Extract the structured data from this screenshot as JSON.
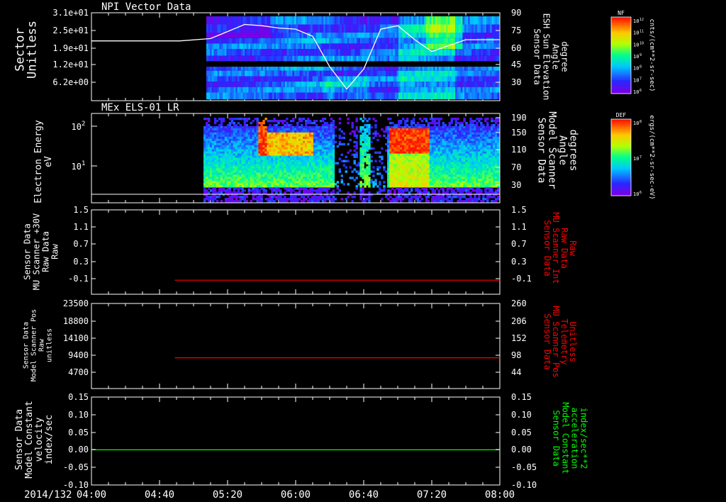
{
  "date_label": "2014/132",
  "time_axis": {
    "start": "04:00",
    "end": "08:00",
    "tick_labels": [
      "04:00",
      "04:40",
      "05:20",
      "06:00",
      "06:40",
      "07:20",
      "08:00"
    ]
  },
  "colors": {
    "background": "#000000",
    "frame": "#ffffff",
    "red_trace": "#ff0000",
    "green_trace": "#00ff00"
  },
  "panels": [
    {
      "id": "npi",
      "title": "NPI Vector Data",
      "left_label": [
        "Sector",
        "Unitless"
      ],
      "left_ticks": [
        "3.1e+01",
        "2.5e+01",
        "1.9e+01",
        "1.2e+01",
        "6.2e+00"
      ],
      "right_label": [
        "Sensor Data",
        "ESH Sun Elevation",
        "Angle",
        "degree"
      ],
      "right_ticks": [
        "90",
        "75",
        "60",
        "45",
        "30"
      ],
      "colorbar": {
        "label": "NF",
        "units": "cnts/(cm**2-sr-sec)",
        "ticks": [
          "10^12",
          "10^11",
          "10^10",
          "10^9",
          "10^8",
          "10^7",
          "10^6"
        ]
      }
    },
    {
      "id": "els",
      "title": "MEx ELS-01 LR",
      "left_label": [
        "Electron Energy",
        "eV"
      ],
      "left_ticks": [
        "10^2",
        "10^1"
      ],
      "right_label": [
        "Sensor Data",
        "Model Scanner",
        "Angle",
        "degrees"
      ],
      "right_ticks": [
        "190",
        "150",
        "110",
        "70",
        "30"
      ],
      "colorbar": {
        "label": "DEF",
        "units": "ergs/(cm**2-sr-sec-eV)",
        "ticks": [
          "10^8",
          "10^7",
          "10^6"
        ]
      }
    },
    {
      "id": "mu_int",
      "left_label": [
        "Sensor Data",
        "MU Scanner +30V",
        "Raw Data",
        "Raw"
      ],
      "left_ticks": [
        "1.5",
        "1.1",
        "0.7",
        "0.3",
        "-0.1"
      ],
      "right_label": [
        "Sensor Data",
        "MU Scanner Int",
        "Raw Data",
        "Raw"
      ],
      "right_ticks": [
        "1.5",
        "1.1",
        "0.7",
        "0.3",
        "-0.1"
      ]
    },
    {
      "id": "mu_pos",
      "left_label": [
        "Sensor Data",
        "Model Scanner Pos",
        "Raw",
        "unitless"
      ],
      "left_ticks": [
        "23500",
        "18800",
        "14100",
        "9400",
        "4700"
      ],
      "right_label": [
        "Sensor Data",
        "MU Scanner Pos",
        "Telemetry",
        "Unitless"
      ],
      "right_ticks": [
        "260",
        "206",
        "152",
        "98",
        "44"
      ]
    },
    {
      "id": "model_const",
      "left_label": [
        "Sensor Data",
        "Model Constant",
        "velocity",
        "index/sec"
      ],
      "left_ticks": [
        "0.15",
        "0.10",
        "0.05",
        "0.00",
        "-0.05",
        "-0.10"
      ],
      "right_label": [
        "Sensor Data",
        "Model Constant",
        "acceleration",
        "index/sec**2"
      ],
      "right_ticks": [
        "0.15",
        "0.10",
        "0.05",
        "0.00",
        "-0.05",
        "-0.10"
      ]
    }
  ],
  "chart_data": [
    {
      "type": "heatmap",
      "title": "NPI Vector Data",
      "ylabel": "Sector Unitless",
      "y2label": "Sensor Data ESH Sun Elevation Angle degree",
      "xlim": [
        "04:00",
        "08:00"
      ],
      "ylim": [
        0,
        31
      ],
      "y2lim": [
        15,
        90
      ],
      "data_start": "04:52",
      "overlay_series": {
        "name": "ESH Sun Elevation Angle",
        "x": [
          "04:00",
          "04:52",
          "05:10",
          "05:20",
          "05:30",
          "05:40",
          "05:50",
          "06:00",
          "06:10",
          "06:20",
          "06:30",
          "06:40",
          "06:50",
          "07:00",
          "07:10",
          "07:20",
          "07:30",
          "07:40",
          "08:00"
        ],
        "y": [
          66,
          66,
          68,
          74,
          80,
          79,
          77,
          76,
          70,
          44,
          25,
          42,
          76,
          79,
          67,
          57,
          62,
          67,
          67
        ]
      }
    },
    {
      "type": "heatmap",
      "title": "MEx ELS-01 LR",
      "ylabel": "Electron Energy eV",
      "y2label": "Sensor Data Model Scanner Angle degrees",
      "yscale": "log",
      "ylim": [
        1,
        200
      ],
      "y2lim": [
        0,
        190
      ],
      "data_start": "04:52",
      "scanner_angle": {
        "x": [
          "04:00",
          "08:00"
        ],
        "y": [
          10,
          10
        ]
      }
    },
    {
      "type": "line",
      "ylabel": "Sensor Data MU Scanner +30V Raw Data Raw",
      "ylim": [
        -0.3,
        1.5
      ],
      "series": [
        {
          "name": "MU Scanner Int Raw Data Raw",
          "x": [
            "04:49",
            "08:00"
          ],
          "y": [
            0.0,
            0.0
          ],
          "color": "#ff0000"
        }
      ]
    },
    {
      "type": "line",
      "ylabel": "Sensor Data Model Scanner Pos Raw unitless",
      "ylim": [
        0,
        23500
      ],
      "y2lim": [
        0,
        260
      ],
      "series": [
        {
          "name": "MU Scanner Pos Telemetry Unitless",
          "x": [
            "04:49",
            "08:00"
          ],
          "y": [
            8500,
            8500
          ],
          "color": "#ff0000"
        }
      ]
    },
    {
      "type": "line",
      "ylabel": "Sensor Data Model Constant velocity index/sec",
      "ylim": [
        -0.1,
        0.15
      ],
      "series": [
        {
          "name": "Model Constant acceleration index/sec**2",
          "x": [
            "04:00",
            "08:00"
          ],
          "y": [
            0.0,
            0.0
          ],
          "color": "#00ff00"
        }
      ]
    }
  ]
}
